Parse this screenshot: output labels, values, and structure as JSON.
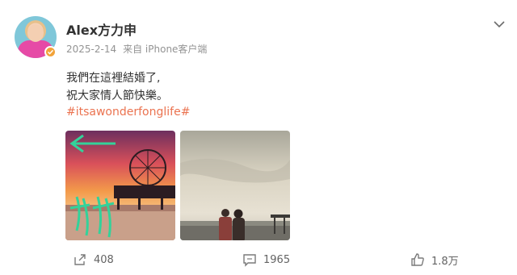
{
  "post": {
    "username": "Alex方力申",
    "date": "2025-2-14",
    "source": "来自 iPhone客户端",
    "text_line_1": "我們在這裡結婚了,",
    "text_line_2": "祝大家情人節快樂。",
    "hashtag": "#itsawonderfonglife#"
  },
  "actions": {
    "forward_count": "408",
    "comment_count": "1965",
    "like_count": "1.8万"
  },
  "icons": {
    "more": "chevron-down-icon",
    "forward": "share-icon",
    "comment": "comment-icon",
    "like": "thumbs-up-icon",
    "verified": "verified-badge-icon"
  },
  "colors": {
    "hashtag": "#eb7350",
    "username": "#333333",
    "meta": "#939393",
    "verified_badge": "#f2a33a"
  }
}
